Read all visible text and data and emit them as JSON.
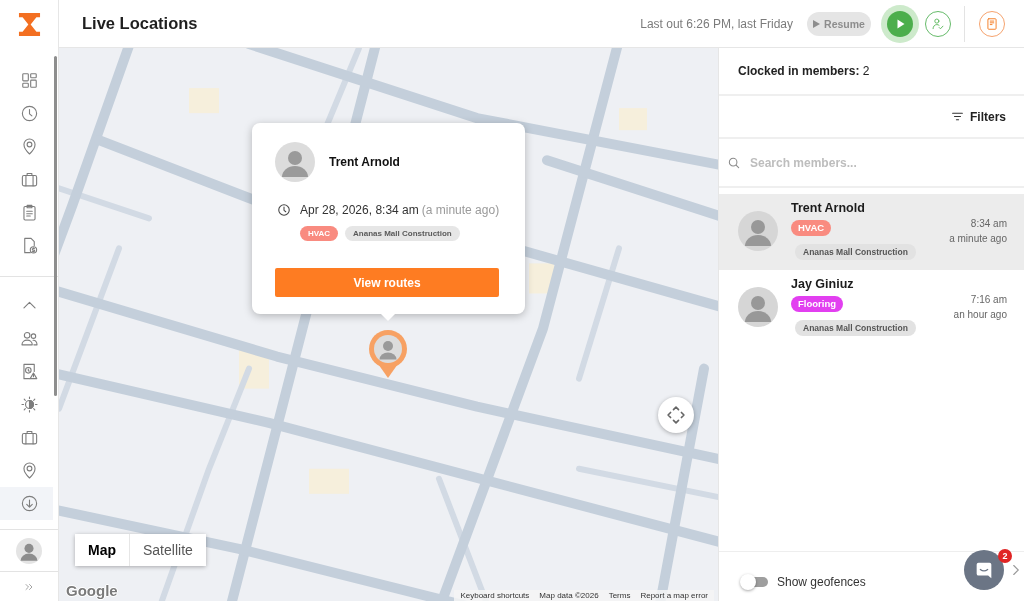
{
  "sidebar": {
    "main_items": [
      {
        "selected": false
      },
      {
        "selected": false
      },
      {
        "selected": false
      },
      {
        "selected": false
      },
      {
        "selected": false
      },
      {
        "selected": false
      }
    ],
    "section": {
      "expanded": true,
      "items": [
        {
          "selected": false
        },
        {
          "selected": false
        },
        {
          "selected": false
        },
        {
          "selected": false
        },
        {
          "selected": false
        },
        {
          "selected": true
        }
      ]
    }
  },
  "header": {
    "title": "Live Locations",
    "last_out": "Last out 6:26 PM, last Friday",
    "resume_button": {
      "label": "Resume",
      "disabled": true
    }
  },
  "map": {
    "popup": {
      "name": "Trent Arnold",
      "datetime": "Apr 28, 2026, 8:34 am",
      "ago": "(a minute ago)",
      "trade": {
        "label": "HVAC",
        "color": "#f98b80"
      },
      "project": "Ananas Mall Construction",
      "button": "View routes"
    },
    "map_types": [
      {
        "label": "Map",
        "selected": true
      },
      {
        "label": "Satellite",
        "selected": false
      }
    ],
    "logo": "Google",
    "attribution": [
      "Keyboard shortcuts",
      "Map data ©2026",
      "Terms",
      "Report a map error"
    ]
  },
  "panel": {
    "clocked_in": "**Clocked in members:** 2",
    "filters": "Filters",
    "search": {
      "placeholder": "Search members..."
    },
    "members": [
      {
        "name": "Trent Arnold",
        "selected": true,
        "trade": {
          "label": "HVAC",
          "color": "#f98b80"
        },
        "project": "Ananas Mall Construction",
        "time": "8:34 am",
        "ago": "a minute ago"
      },
      {
        "name": "Jay Giniuz",
        "selected": false,
        "trade": {
          "label": "Flooring",
          "color": "#e23ff0"
        },
        "project": "Ananas Mall Construction",
        "time": "7:16 am",
        "ago": "an hour ago"
      }
    ],
    "geofence_toggle": {
      "label": "Show geofences",
      "on": false
    },
    "chat": {
      "badge": "2"
    }
  }
}
